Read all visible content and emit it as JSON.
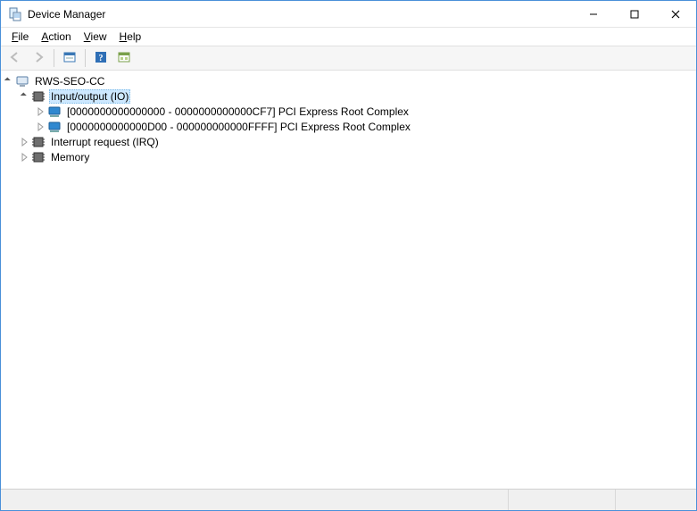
{
  "window": {
    "title": "Device Manager"
  },
  "menu": {
    "file": "File",
    "action": "Action",
    "view": "View",
    "help": "Help"
  },
  "toolbar": {
    "back": "Back",
    "forward": "Forward",
    "properties": "Properties",
    "help": "Help",
    "resources_by_connection": "Resources by connection"
  },
  "tree": {
    "root": {
      "label": "RWS-SEO-CC"
    },
    "io": {
      "label": "Input/output (IO)"
    },
    "io_child1": {
      "label": "[0000000000000000 - 0000000000000CF7]  PCI Express Root Complex"
    },
    "io_child2": {
      "label": "[0000000000000D00 - 000000000000FFFF]  PCI Express Root Complex"
    },
    "irq": {
      "label": "Interrupt request (IRQ)"
    },
    "memory": {
      "label": "Memory"
    }
  }
}
